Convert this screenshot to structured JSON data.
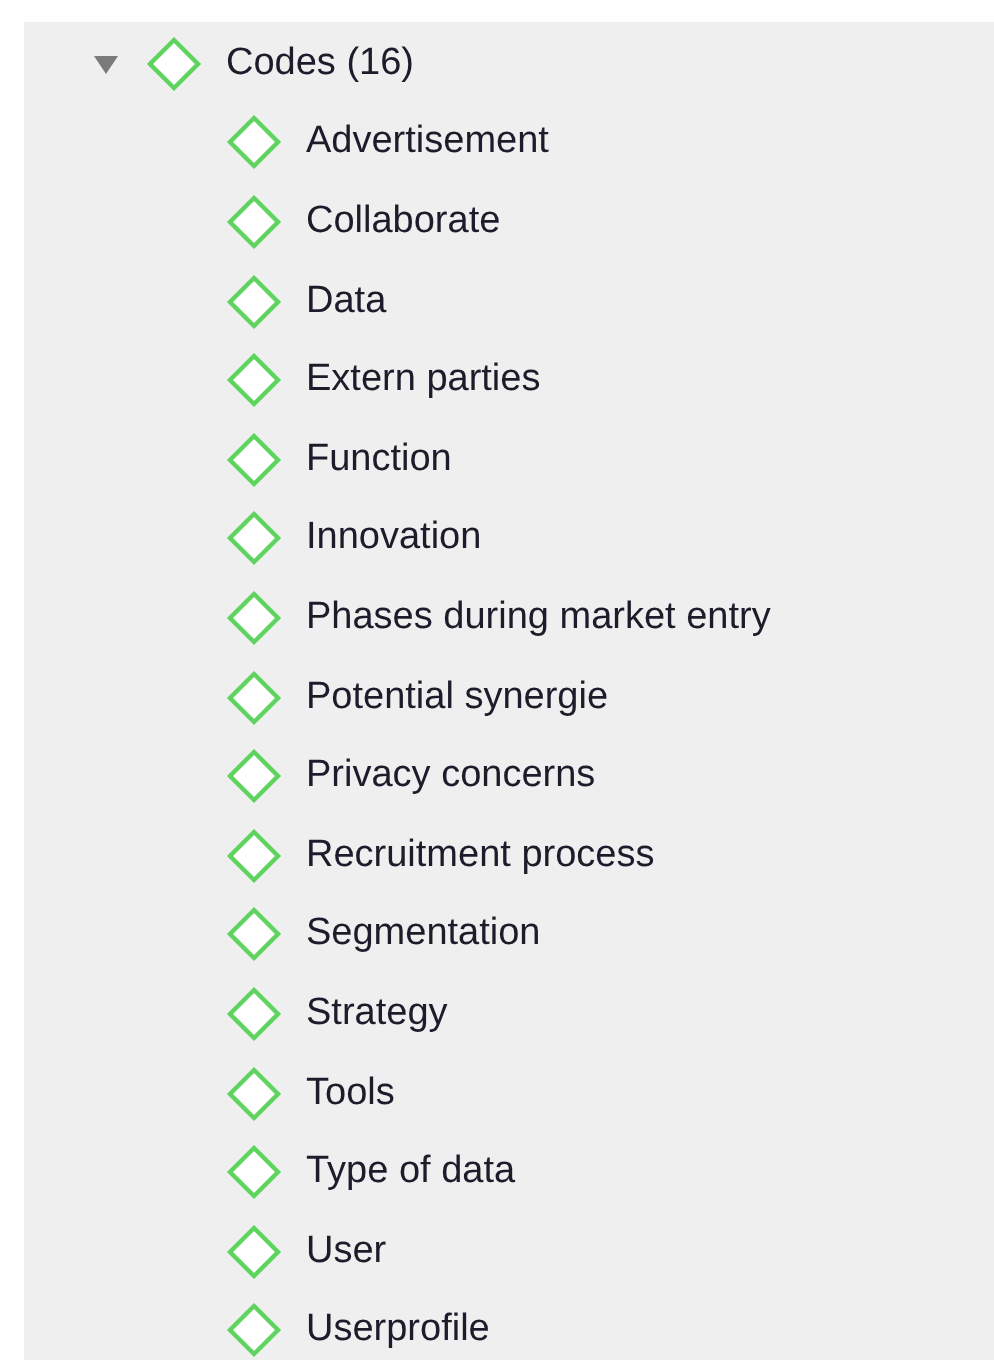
{
  "tree": [
    {
      "label": "Codes (16)",
      "expanded": true,
      "children": [
        {
          "label": "Advertisement"
        },
        {
          "label": "Collaborate"
        },
        {
          "label": "Data"
        },
        {
          "label": "Extern parties"
        },
        {
          "label": "Function"
        },
        {
          "label": "Innovation"
        },
        {
          "label": "Phases during market entry"
        },
        {
          "label": "Potential synergie"
        },
        {
          "label": "Privacy concerns"
        },
        {
          "label": "Recruitment process"
        },
        {
          "label": "Segmentation"
        },
        {
          "label": "Strategy"
        },
        {
          "label": "Tools"
        },
        {
          "label": "Type of data"
        },
        {
          "label": "User"
        },
        {
          "label": "Userprofile"
        }
      ]
    }
  ]
}
